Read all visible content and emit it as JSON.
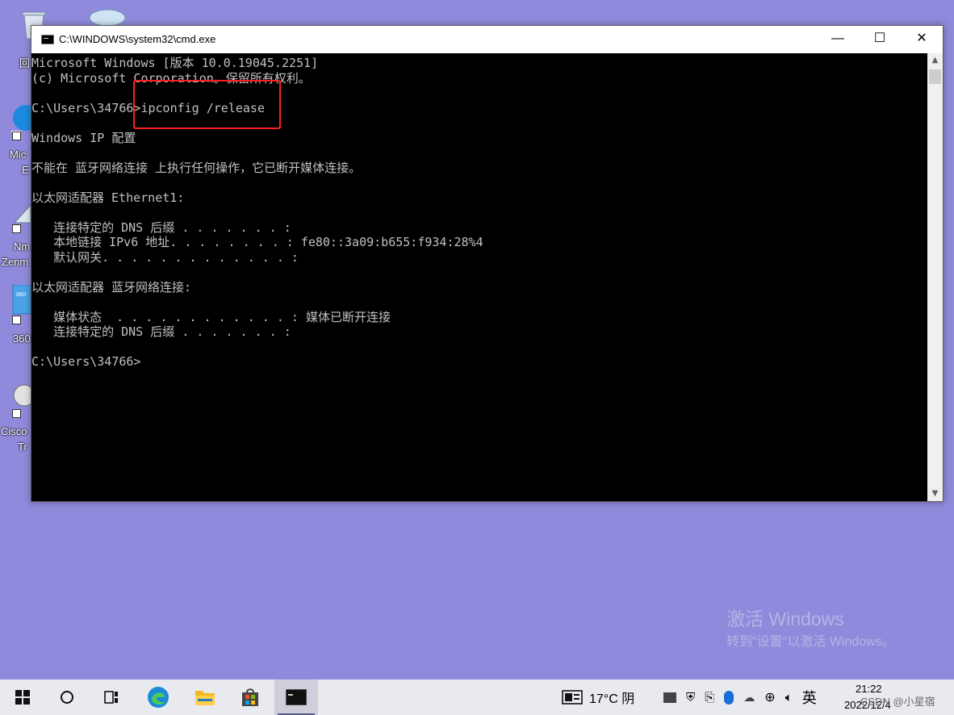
{
  "window": {
    "title": "C:\\WINDOWS\\system32\\cmd.exe",
    "min": "—",
    "max": "☐",
    "close": "✕"
  },
  "console": {
    "lines": [
      "Microsoft Windows [版本 10.0.19045.2251]",
      "(c) Microsoft Corporation。保留所有权利。",
      "",
      "C:\\Users\\34766>ipconfig /release",
      "",
      "Windows IP 配置",
      "",
      "不能在 蓝牙网络连接 上执行任何操作，它已断开媒体连接。",
      "",
      "以太网适配器 Ethernet1:",
      "",
      "   连接特定的 DNS 后缀 . . . . . . . :",
      "   本地链接 IPv6 地址. . . . . . . . : fe80::3a09:b655:f934:28%4",
      "   默认网关. . . . . . . . . . . . . :",
      "",
      "以太网适配器 蓝牙网络连接:",
      "",
      "   媒体状态  . . . . . . . . . . . . : 媒体已断开连接",
      "   连接特定的 DNS 后缀 . . . . . . . :",
      "",
      "C:\\Users\\34766>"
    ]
  },
  "desktop": {
    "labels": [
      "回",
      "Mic",
      "E",
      "Nm",
      "Zenm",
      "360",
      "Cisco",
      "Tr"
    ]
  },
  "watermark": {
    "title": "激活 Windows",
    "subtitle": "转到\"设置\"以激活 Windows。"
  },
  "taskbar": {
    "weather": "17°C 阴",
    "ime": "英",
    "time": "21:22",
    "date": "2022/12/4",
    "csdn": "CSDN @小星宿"
  }
}
